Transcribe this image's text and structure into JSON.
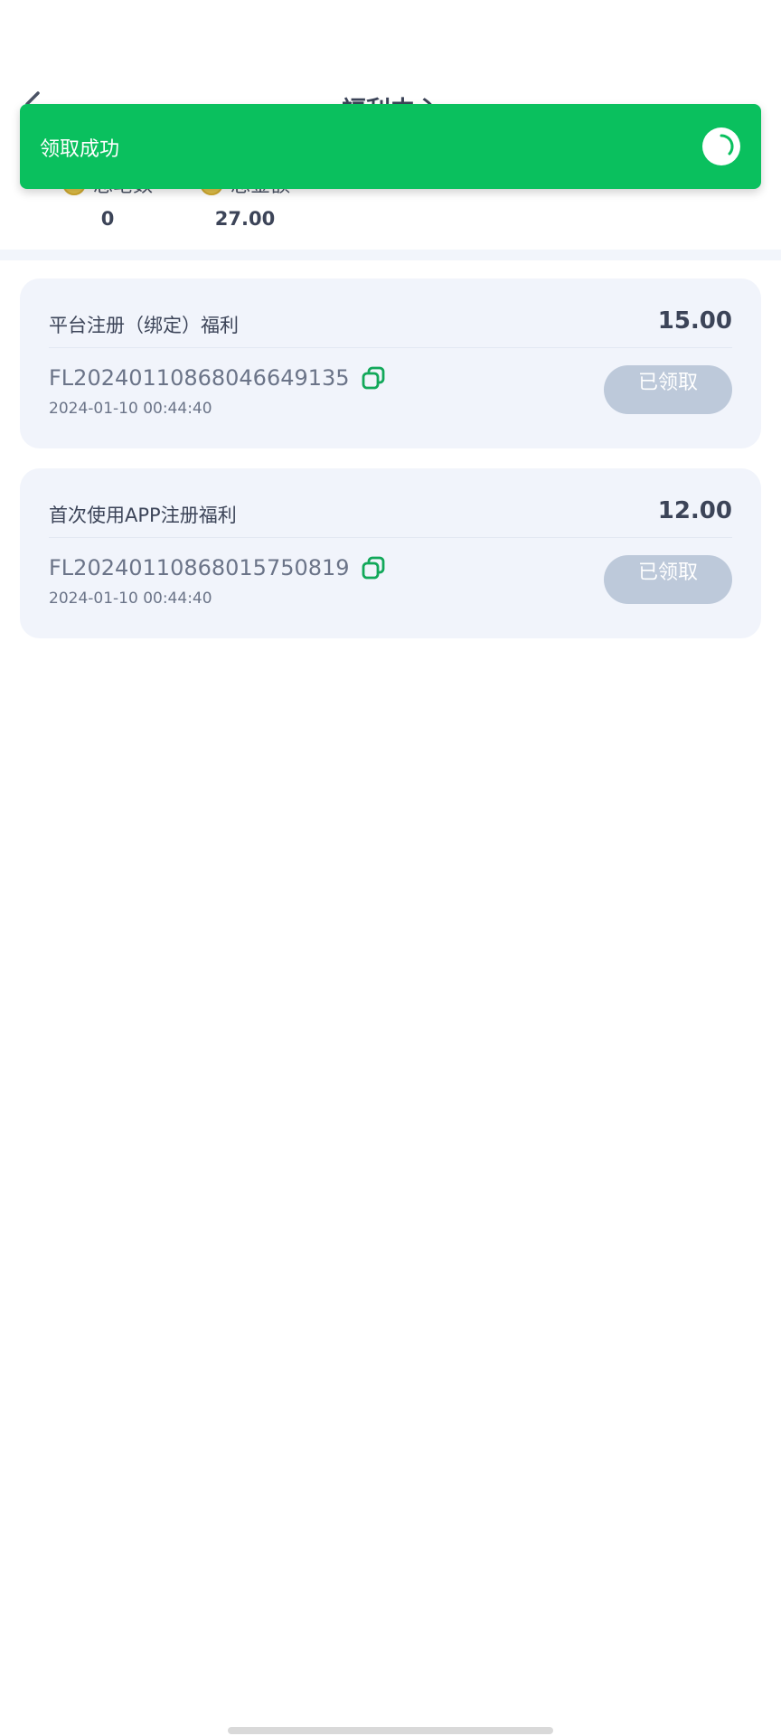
{
  "header": {
    "title": "福利中心",
    "back_icon": "chevron-left-icon"
  },
  "summary": {
    "count_label": "总笔数",
    "count_value": "0",
    "amount_label": "总金额",
    "amount_value": "27.00",
    "coin_icon": "coin-icon"
  },
  "cards": [
    {
      "title": "平台注册（绑定）福利",
      "amount": "15.00",
      "code": "FL20240110868046649135",
      "date": "2024-01-10 00:44:40",
      "button": "已领取"
    },
    {
      "title": "首次使用APP注册福利",
      "amount": "12.00",
      "code": "FL20240110868015750819",
      "date": "2024-01-10 00:44:40",
      "button": "已领取"
    }
  ],
  "toast": {
    "message": "领取成功",
    "icon": "spinner-icon"
  },
  "colors": {
    "toast_bg": "#0ac05e",
    "card_bg": "#f1f4fb",
    "claimed_btn_bg": "#bdc9da",
    "copy_icon": "#12a85a"
  }
}
